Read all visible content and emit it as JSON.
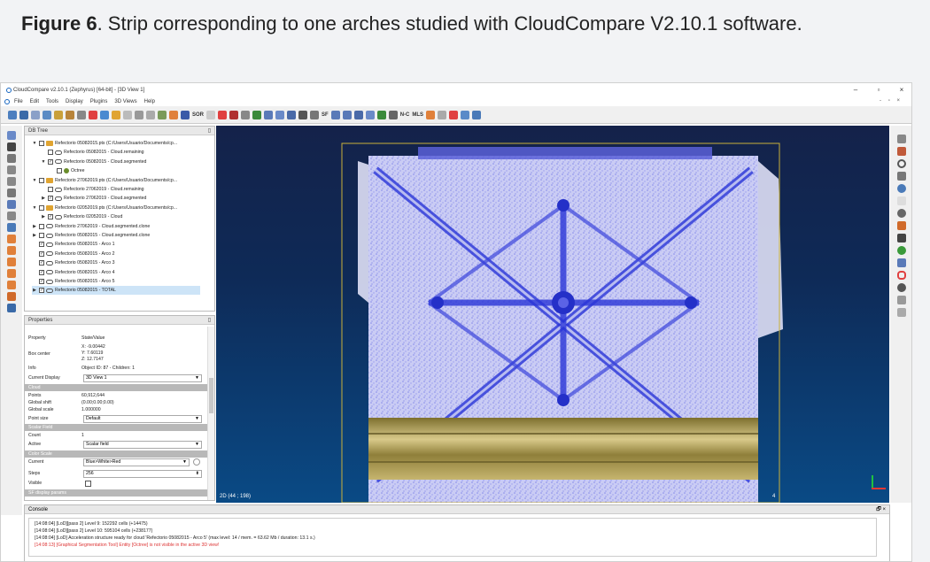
{
  "caption": {
    "label": "Figure 6",
    "text": ". Strip corresponding to one arches studied with CloudCompare V2.10.1 software."
  },
  "window": {
    "title": "CloudCompare v2.10.1 (Zephyrus) [64-bit] - [3D View 1]",
    "minimize": "–",
    "restore": "▫",
    "close": "×"
  },
  "menu": {
    "items": [
      "File",
      "Edit",
      "Tools",
      "Display",
      "Plugins",
      "3D Views",
      "Help"
    ],
    "mdi_controls": "- ▫ ×"
  },
  "toolbar": {
    "sor_label": "SOR",
    "sf_label": "SF",
    "nc_label": "N-C",
    "mls_label": "MLS"
  },
  "dbtree": {
    "title": "DB Tree",
    "pin": "▯",
    "rows": [
      {
        "indent": 0,
        "arrow": "▼",
        "checked": false,
        "icon": "folder",
        "label": "Refectorio 05082015.pts (C:/Users/Usuario/Documents/cp..."
      },
      {
        "indent": 1,
        "arrow": "",
        "checked": false,
        "icon": "cloud",
        "label": "Refectorio 05082015 - Cloud.remaining"
      },
      {
        "indent": 1,
        "arrow": "▼",
        "checked": true,
        "icon": "cloud",
        "label": "Refectorio 05082015 - Cloud.segmented"
      },
      {
        "indent": 2,
        "arrow": "",
        "checked": false,
        "icon": "octree",
        "label": "Octree"
      },
      {
        "indent": 0,
        "arrow": "▼",
        "checked": false,
        "icon": "folder",
        "label": "Refectorio 27062019.pts (C:/Users/Usuario/Documents/cp..."
      },
      {
        "indent": 1,
        "arrow": "",
        "checked": false,
        "icon": "cloud",
        "label": "Refectorio 27062019 - Cloud.remaining"
      },
      {
        "indent": 1,
        "arrow": "▶",
        "checked": true,
        "icon": "cloud",
        "label": "Refectorio 27062019 - Cloud.segmented"
      },
      {
        "indent": 0,
        "arrow": "▼",
        "checked": false,
        "icon": "folder",
        "label": "Refectorio 02052019.pts (C:/Users/Usuario/Documents/cp..."
      },
      {
        "indent": 1,
        "arrow": "▶",
        "checked": true,
        "icon": "cloud",
        "label": "Refectorio 02052019 - Cloud"
      },
      {
        "indent": 0,
        "arrow": "▶",
        "checked": false,
        "icon": "cloud",
        "label": "Refectorio 27062019 - Cloud.segmented.clone"
      },
      {
        "indent": 0,
        "arrow": "▶",
        "checked": false,
        "icon": "cloud",
        "label": "Refectorio 05082015 - Cloud.segmented.clone"
      },
      {
        "indent": 0,
        "arrow": "",
        "checked": true,
        "icon": "cloud",
        "label": "Refectorio 05082015 - Arco 1"
      },
      {
        "indent": 0,
        "arrow": "",
        "checked": true,
        "icon": "cloud",
        "label": "Refectorio 05082015 - Arco 2"
      },
      {
        "indent": 0,
        "arrow": "",
        "checked": true,
        "icon": "cloud",
        "label": "Refectorio 05082015 - Arco 3"
      },
      {
        "indent": 0,
        "arrow": "",
        "checked": true,
        "icon": "cloud",
        "label": "Refectorio 05082015 - Arco 4"
      },
      {
        "indent": 0,
        "arrow": "",
        "checked": true,
        "icon": "cloud",
        "label": "Refectorio 05082015 - Arco 5"
      },
      {
        "indent": 0,
        "arrow": "▶",
        "checked": true,
        "icon": "cloud",
        "label": "Refectorio 05082015 - TOTAL",
        "selected": true
      }
    ]
  },
  "properties": {
    "title": "Properties",
    "pin": "▯",
    "header_key": "Property",
    "header_val": "State/Value",
    "box_center_label": "Box center",
    "box_center": [
      "X: -9.00442",
      "Y: 7.60119",
      "Z: 12.7147"
    ],
    "info_label": "Info",
    "info_value": "Object ID: 87 - Children: 1",
    "current_display_label": "Current Display",
    "current_display_value": "3D View 1",
    "cloud_section": "Cloud",
    "points_label": "Points",
    "points_value": "60,912,644",
    "global_shift_label": "Global shift",
    "global_shift_value": "(0.00;0.00;0.00)",
    "global_scale_label": "Global scale",
    "global_scale_value": "1.000000",
    "point_size_label": "Point size",
    "point_size_value": "Default",
    "scalar_field_section": "Scalar Field",
    "count_label": "Count",
    "count_value": "1",
    "active_label": "Active",
    "active_value": "Scalar field",
    "color_scale_section": "Color Scale",
    "current_label": "Current",
    "current_value": "Blue>White>Red",
    "steps_label": "Steps",
    "steps_value": "256",
    "visible_label": "Visible",
    "sf_display_section": "SF display params"
  },
  "view3d": {
    "status": "2D (44 ; 198)",
    "frame_number": "4"
  },
  "console": {
    "title": "Console",
    "controls": "🗗 ×",
    "lines": [
      {
        "text": "[14:08:04] [LoD][pass 2] Level 9: 152292 cells (+14475)",
        "warn": false
      },
      {
        "text": "[14:08:04] [LoD][pass 2] Level 10: 595104 cells (+238177)",
        "warn": false
      },
      {
        "text": "[14:08:04] [LoD] Acceleration structure ready for cloud 'Refectorio 05082015 - Arco 5' (max level: 14 / mem. = 63.62 Mb / duration: 13.1 s.)",
        "warn": false
      },
      {
        "text": "[14:08:13] [Graphical Segmentation Tool] Entity [Octree] is not visible in the active 3D view!",
        "warn": true
      }
    ]
  },
  "colors": {
    "view_bg": "#0e2a57",
    "vault_fill": "#6f74e8",
    "rib": "#2a35d8",
    "gold": "#b5a45a",
    "warning": "#dd3333"
  }
}
